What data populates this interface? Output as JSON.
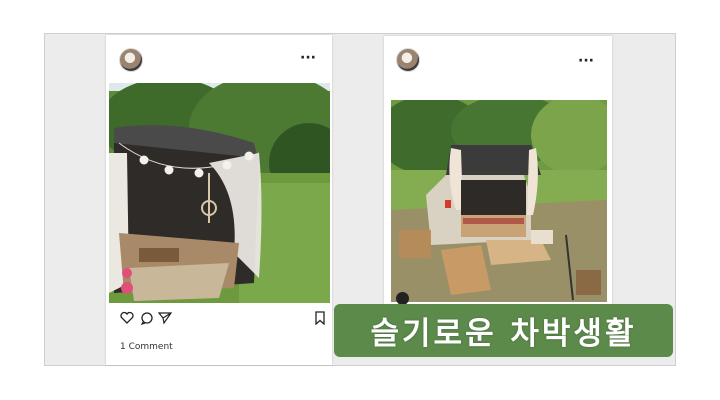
{
  "posts": [
    {
      "more_icon": "more-horizontal-icon",
      "actions": [
        "heart-icon",
        "comment-icon",
        "share-icon",
        "bookmark-icon"
      ],
      "comment_count": "1 Comment"
    },
    {
      "more_icon": "more-horizontal-icon",
      "user_icon": "user-tag-icon"
    }
  ],
  "caption": {
    "text": "슬기로운 차박생활",
    "background": "#5c8a4b",
    "color": "#ffffff"
  }
}
